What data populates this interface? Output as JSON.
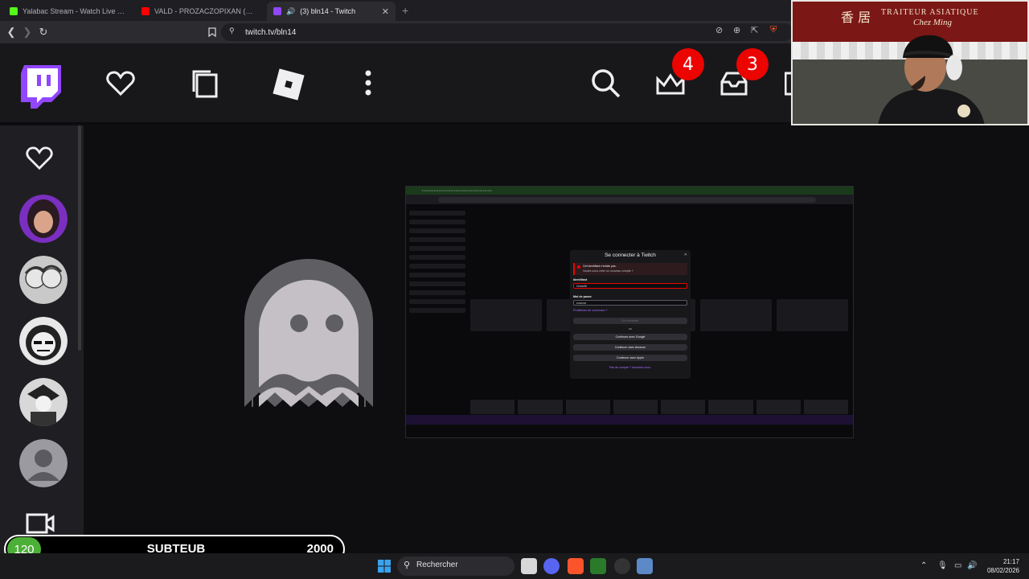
{
  "browser": {
    "tabs": [
      {
        "title": "Yalabac Stream - Watch Live on Kick",
        "icon": "kick-icon",
        "color": "#53fc18"
      },
      {
        "title": "VALD - PROZACZOPIXAN (Clip offici...",
        "icon": "youtube-icon",
        "color": "#ff0000"
      },
      {
        "title": "(3) bln14 - Twitch",
        "icon": "twitch-icon",
        "color": "#9146ff"
      }
    ],
    "url": "twitch.tv/bln14"
  },
  "header": {
    "notifications_count": "4",
    "inbox_count": "3"
  },
  "login_modal": {
    "title": "Se connecter à Twitch",
    "error_line1": "Cet identifiant n'existe pas.",
    "error_line2": "Voulez-vous créer un nouveau compte ?",
    "username_label": "Identifiant",
    "username_value": "Chessfit",
    "password_label": "Mot de passe",
    "password_value": "••••••••••",
    "trouble_link": "Problèmes de connexion ?",
    "login_button": "Se connecter",
    "or_text": "ou",
    "google_button": "Continuer avec Google",
    "amazon_button": "Continuer avec Amazon",
    "apple_button": "Continuer avec Apple",
    "signup_link": "Pas de compte ? Inscrivez-vous."
  },
  "webcam": {
    "shop_sign": "TRAITEUR ASIATIQUE",
    "shop_sign2": "Chez Ming",
    "shop_chars": "香 居"
  },
  "subgoal": {
    "current": "120",
    "label": "SUBTEUB",
    "target": "2000"
  },
  "taskbar": {
    "search_placeholder": "Rechercher",
    "time": "21:17",
    "date": "08/02/2026"
  },
  "colors": {
    "twitch_purple": "#9146ff",
    "badge_red": "#eb0400",
    "goal_green": "#4caf37"
  }
}
